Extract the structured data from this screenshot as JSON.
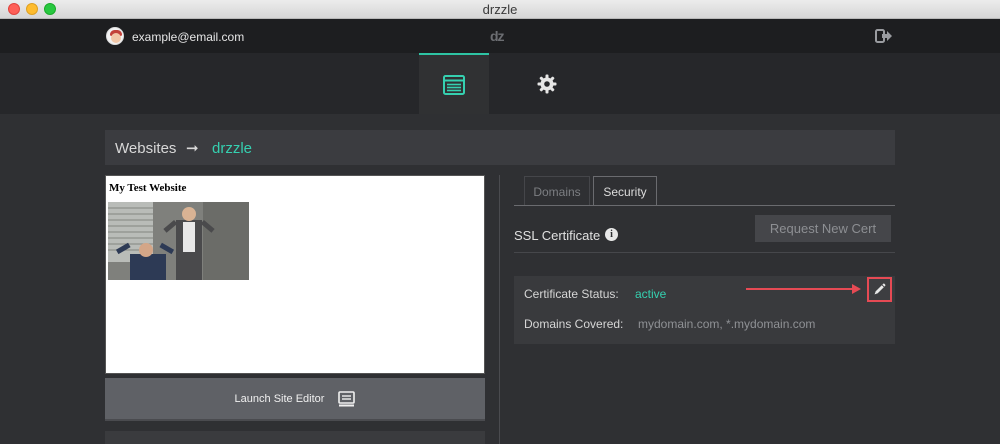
{
  "window": {
    "title": "drzzle"
  },
  "header": {
    "email": "example@email.com",
    "brand": "dz"
  },
  "nav": {
    "active_tab_icon": "website-icon",
    "settings_icon": "gear-icon",
    "accent": "#2ec4a4"
  },
  "breadcrumb": {
    "root": "Websites",
    "separator": "➞",
    "current": "drzzle"
  },
  "preview": {
    "site_title": "My Test Website"
  },
  "launch": {
    "label": "Launch Site Editor",
    "icon": "editor-icon"
  },
  "tabs": [
    {
      "label": "Domains",
      "active": false
    },
    {
      "label": "Security",
      "active": true
    }
  ],
  "ssl": {
    "label": "SSL Certificate",
    "info_icon": "i",
    "request_button": "Request New Cert",
    "status_label": "Certificate Status:",
    "status_value": "active",
    "domains_label": "Domains Covered:",
    "domains_value": "mydomain.com, *.mydomain.com"
  },
  "colors": {
    "active": "#35d0b0",
    "highlight": "#e64a54"
  }
}
